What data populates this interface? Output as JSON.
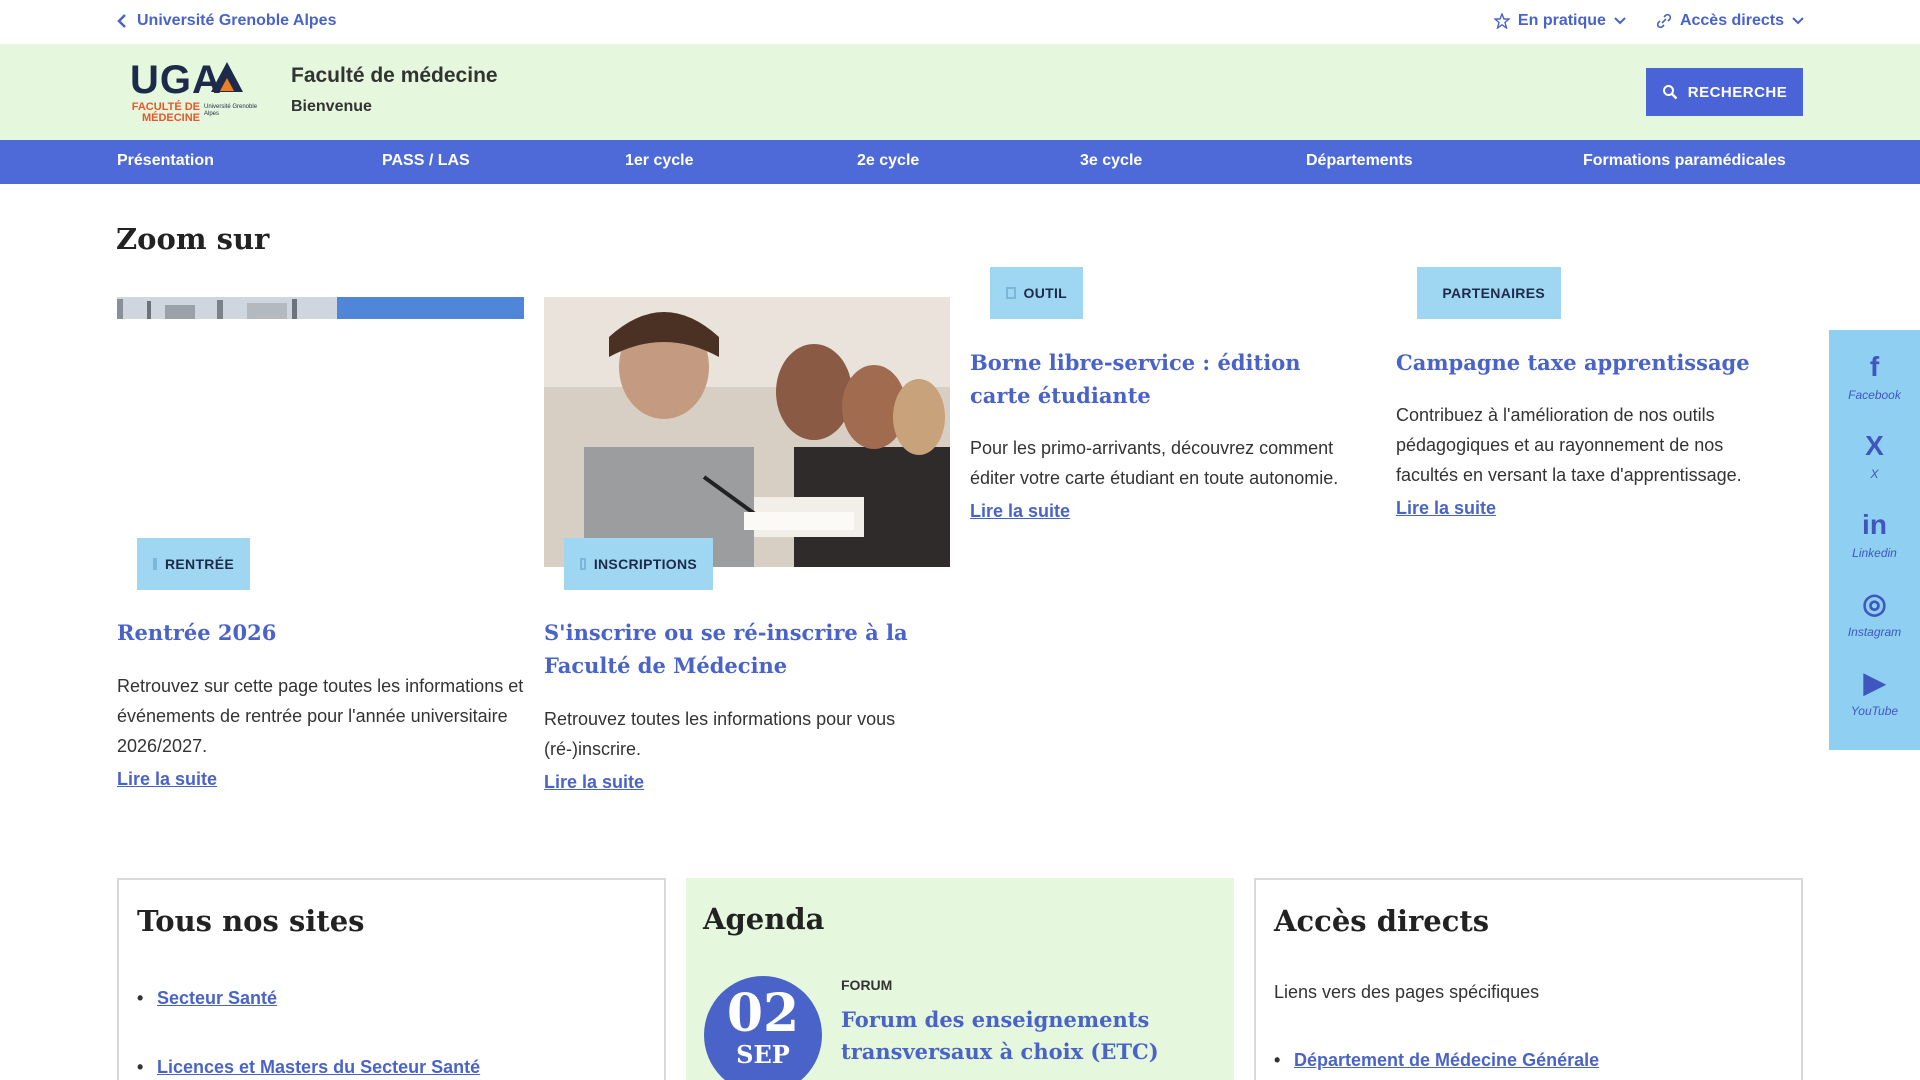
{
  "topbar": {
    "back_label": "Université Grenoble Alpes",
    "en_pratique": "En pratique",
    "acces_directs": "Accès directs"
  },
  "header": {
    "logo_text": "UGA",
    "logo_faculty": "FACULTÉ DE MÉDECINE",
    "logo_university": "Université Grenoble Alpes",
    "title": "Faculté de médecine",
    "subtitle": "Bienvenue",
    "search_label": "RECHERCHE"
  },
  "nav": [
    {
      "label": "Présentation"
    },
    {
      "label": "PASS / LAS"
    },
    {
      "label": "1er cycle"
    },
    {
      "label": "2e cycle"
    },
    {
      "label": "3e cycle"
    },
    {
      "label": "Départements"
    },
    {
      "label": "Formations paramédicales"
    }
  ],
  "zoom": {
    "title": "Zoom sur",
    "cards": [
      {
        "tag": "RENTRÉE",
        "title": "Rentrée 2026",
        "text": "Retrouvez sur cette page toutes les informations et événements de rentrée pour l'année universitaire 2026/2027.",
        "link": "Lire la suite"
      },
      {
        "tag": "INSCRIPTIONS",
        "title": "S'inscrire ou se ré-inscrire à la Faculté de Médecine",
        "text": "Retrouvez toutes les informations pour vous (ré-)inscrire.",
        "link": "Lire la suite"
      },
      {
        "tag": "OUTIL",
        "title": "Borne libre-service : édition carte étudiante",
        "text": "Pour les primo-arrivants, découvrez comment éditer votre carte étudiant en toute autonomie.",
        "link": "Lire la suite"
      },
      {
        "tag": "PARTENAIRES",
        "title": "Campagne taxe apprentissage",
        "text": "Contribuez à l'amélioration de nos outils pédagogiques et au rayonnement de nos facultés en versant la taxe d'apprentissage.",
        "link": "Lire la suite"
      }
    ]
  },
  "social": [
    {
      "icon": "facebook-icon",
      "glyph": "f",
      "label": "Facebook"
    },
    {
      "icon": "x-icon",
      "glyph": "X",
      "label": "X"
    },
    {
      "icon": "linkedin-icon",
      "glyph": "in",
      "label": "Linkedin"
    },
    {
      "icon": "instagram-icon",
      "glyph": "◎",
      "label": "Instagram"
    },
    {
      "icon": "youtube-icon",
      "glyph": "▶",
      "label": "YouTube"
    }
  ],
  "sites": {
    "title": "Tous nos sites",
    "items": [
      "Secteur Santé",
      "Licences et Masters du Secteur Santé"
    ]
  },
  "agenda": {
    "title": "Agenda",
    "day": "02",
    "month": "SEP",
    "type": "FORUM",
    "event_title": "Forum des enseignements transversaux à choix (ETC)"
  },
  "acces": {
    "title": "Accès directs",
    "description": "Liens vers des pages spécifiques",
    "items": [
      "Département de Médecine Générale"
    ]
  },
  "colors": {
    "primary": "#4a63c8",
    "nav_bg": "#4d6ad8",
    "header_bg": "#e5f7dd",
    "tag_bg": "#9fd7f3",
    "social_bg": "#8fd0f2"
  }
}
